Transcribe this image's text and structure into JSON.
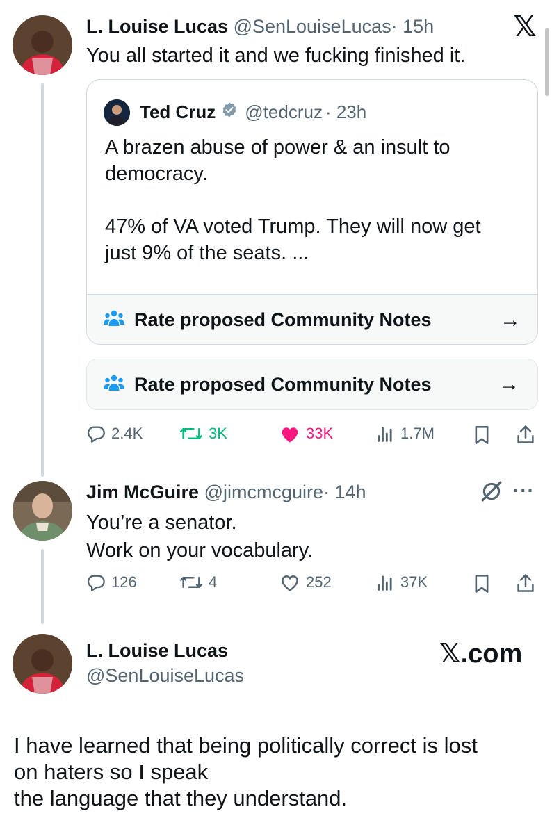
{
  "x_logo": "𝕏",
  "tweet1": {
    "author": "L. Louise Lucas",
    "handle": "@SenLouiseLucas",
    "time": "· 15h",
    "text": "You all started it and we fucking finished it.",
    "quote": {
      "author": "Ted Cruz",
      "handle": "@tedcruz",
      "time": "· 23h",
      "line1": "A brazen abuse of power & an insult to",
      "line2": "democracy.",
      "line3": "47% of VA voted Trump. They will now get",
      "line4": "just 9% of the seats. ...",
      "notes_label": "Rate proposed Community Notes"
    },
    "notes_label": "Rate proposed Community Notes",
    "actions": {
      "replies": "2.4K",
      "reposts": "3K",
      "likes": "33K",
      "views": "1.7M"
    },
    "colors": {
      "repost": "#00ba7c",
      "like": "#f91880"
    }
  },
  "tweet2": {
    "author": "Jim McGuire",
    "handle": "@jimcmcguire",
    "time": "· 14h",
    "line1": "You’re a senator.",
    "line2": "Work on your vocabulary.",
    "more": "···",
    "actions": {
      "replies": "126",
      "reposts": "4",
      "likes": "252",
      "views": "37K"
    }
  },
  "post": {
    "author": "L. Louise Lucas",
    "handle": "@SenLouiseLucas",
    "watermark": "𝕏.com",
    "line1": "I have learned that being politically correct is lost",
    "line2": "on haters so I speak",
    "line3": "the language that they understand."
  },
  "colors": {
    "link_blue": "#1d9bf0",
    "muted": "#536471",
    "border": "#cfd9de"
  }
}
